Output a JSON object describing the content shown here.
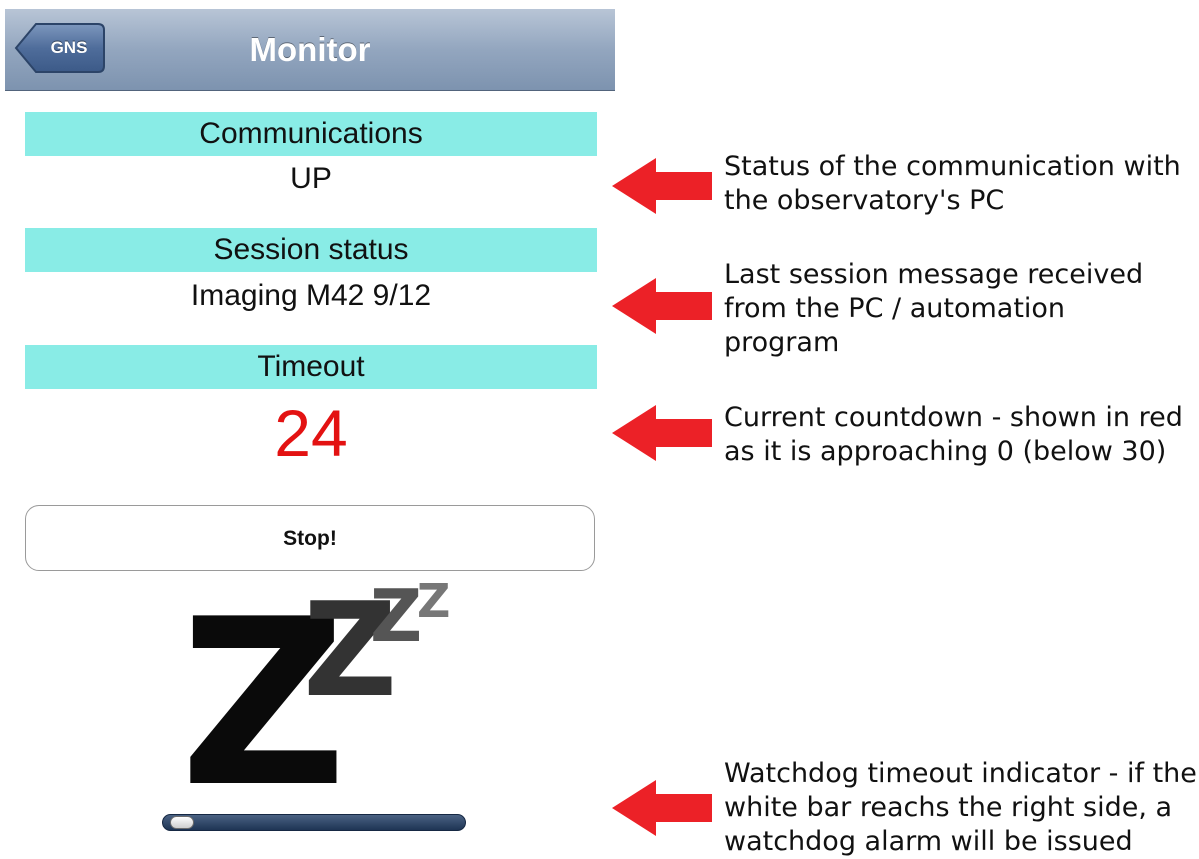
{
  "nav": {
    "back_label": "GNS",
    "title": "Monitor"
  },
  "sections": {
    "communications": {
      "label": "Communications",
      "value": "UP"
    },
    "session": {
      "label": "Session status",
      "value": "Imaging M42 9/12"
    },
    "timeout": {
      "label": "Timeout",
      "value": "24",
      "value_color": "#e31212"
    }
  },
  "stop_button": {
    "label": "Stop!"
  },
  "sleep_indicator": {
    "glyphs": [
      "Z",
      "Z",
      "Z",
      "Z"
    ],
    "icon": "sleeping-zzz-icon"
  },
  "watchdog_progress": {
    "fraction": 0.02
  },
  "annotations": [
    {
      "text": "Status of the communication with\nthe observatory's PC"
    },
    {
      "text": "Last session message received\nfrom the PC / automation\nprogram"
    },
    {
      "text": "Current countdown - shown in red\nas it is approaching 0 (below 30)"
    },
    {
      "text": "Watchdog timeout indicator - if the\nwhite bar reachs the right side, a\nwatchdog alarm will be issued"
    }
  ],
  "colors": {
    "section_header_bg": "#89ece6",
    "arrow": "#ec2127",
    "navbar": "#93a6bf"
  }
}
